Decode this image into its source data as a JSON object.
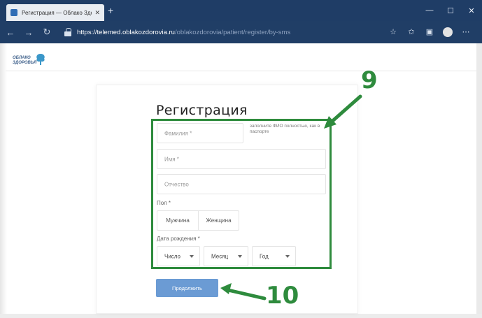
{
  "browser": {
    "tab_title": "Регистрация — Облако Здоро",
    "tab_close": "✕",
    "new_tab": "+",
    "window_controls": [
      "—",
      "☐",
      "✕"
    ],
    "url_main": "https://telemed.oblakozdorovia.ru",
    "url_path": "/oblakozdorovia/patient/register/by-sms",
    "nav_icons": [
      "back-icon",
      "forward-icon",
      "refresh-icon"
    ],
    "toolbar_icons": [
      "star-icon",
      "favorites-icon",
      "collections-icon"
    ]
  },
  "logo": {
    "line1": "ОБЛАКО",
    "line2": "ЗДОРОВЬЯ",
    "brand_color": "#3d5f8a"
  },
  "form": {
    "title": "Регистрация",
    "surname_placeholder": "Фамилия *",
    "name_hint": "заполните ФИО полностью, как в паспорте",
    "name_placeholder": "Имя *",
    "patronymic_placeholder": "Отчество",
    "gender_label": "Пол *",
    "gender_male": "Мужчина",
    "gender_female": "Женщина",
    "birthdate_label": "Дата рождения *",
    "day_select": "Число",
    "month_select": "Месяц",
    "year_select": "Год",
    "submit_label": "Продолжить",
    "submit_color": "#6b9bd4"
  },
  "annotations": {
    "box_label": "9",
    "button_label": "10",
    "color": "#2e8b3d"
  }
}
